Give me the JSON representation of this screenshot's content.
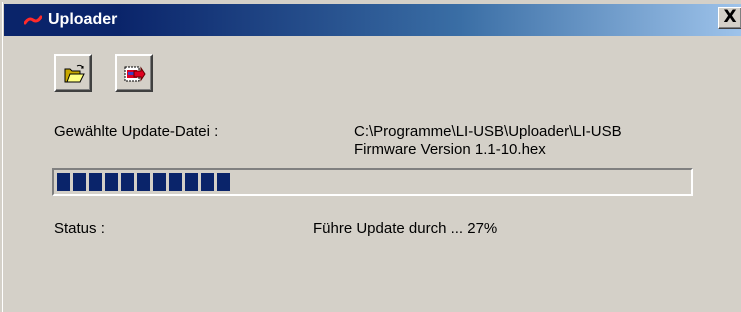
{
  "window": {
    "title": "Uploader",
    "close_label": "X"
  },
  "toolbar": {
    "open_icon": "folder-open-icon",
    "upload_icon": "firmware-upload-icon"
  },
  "file": {
    "label": "Gewählte Update-Datei :",
    "path_line1": "C:\\Programme\\LI-USB\\Uploader\\LI-USB",
    "path_line2": "Firmware Version 1.1-10.hex"
  },
  "progress": {
    "percent": 27,
    "color": "#0a246a"
  },
  "status": {
    "label": "Status :",
    "text": "Führe Update durch ... 27%"
  },
  "colors": {
    "window_bg": "#d4d0c8",
    "titlebar_start": "#0a246a",
    "titlebar_end": "#a6caf0"
  }
}
